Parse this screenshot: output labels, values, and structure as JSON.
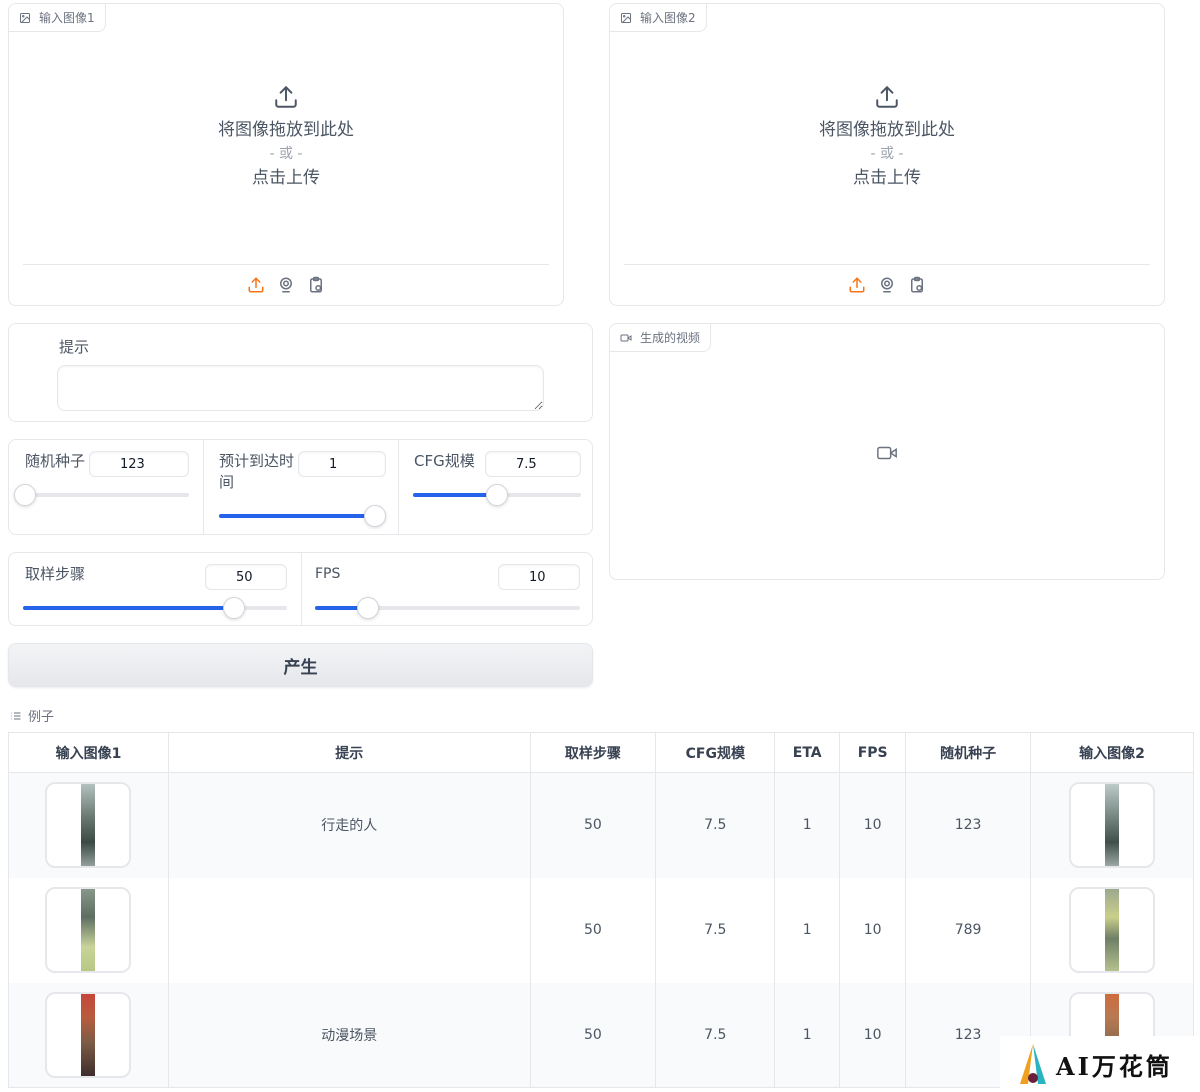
{
  "input1": {
    "label": "输入图像1",
    "drop_text": "将图像拖放到此处",
    "or_text": "- 或 -",
    "click_text": "点击上传"
  },
  "input2": {
    "label": "输入图像2",
    "drop_text": "将图像拖放到此处",
    "or_text": "- 或 -",
    "click_text": "点击上传"
  },
  "output": {
    "label": "生成的视频"
  },
  "prompt": {
    "label": "提示",
    "value": ""
  },
  "sliders": {
    "seed": {
      "label": "随机种子",
      "value": "123",
      "fraction": 0.0
    },
    "eta": {
      "label": "预计到达时间",
      "value": "1",
      "fraction": 1.0
    },
    "cfg": {
      "label": "CFG规模",
      "value": "7.5",
      "fraction": 0.5
    },
    "steps": {
      "label": "取样步骤",
      "value": "50",
      "fraction": 0.8
    },
    "fps": {
      "label": "FPS",
      "value": "10",
      "fraction": 0.2
    }
  },
  "generate_label": "产生",
  "examples": {
    "label": "例子",
    "headers": [
      "输入图像1",
      "提示",
      "取样步骤",
      "CFG规模",
      "ETA",
      "FPS",
      "随机种子",
      "输入图像2"
    ],
    "rows": [
      {
        "prompt": "行走的人",
        "steps": "50",
        "cfg": "7.5",
        "eta": "1",
        "fps": "10",
        "seed": "123"
      },
      {
        "prompt": "",
        "steps": "50",
        "cfg": "7.5",
        "eta": "1",
        "fps": "10",
        "seed": "789"
      },
      {
        "prompt": "动漫场景",
        "steps": "50",
        "cfg": "7.5",
        "eta": "1",
        "fps": "10",
        "seed": "123"
      }
    ]
  },
  "watermark": {
    "text": "AI万花筒"
  },
  "colors": {
    "accent": "#2563eb",
    "upload_orange": "#f97316"
  }
}
